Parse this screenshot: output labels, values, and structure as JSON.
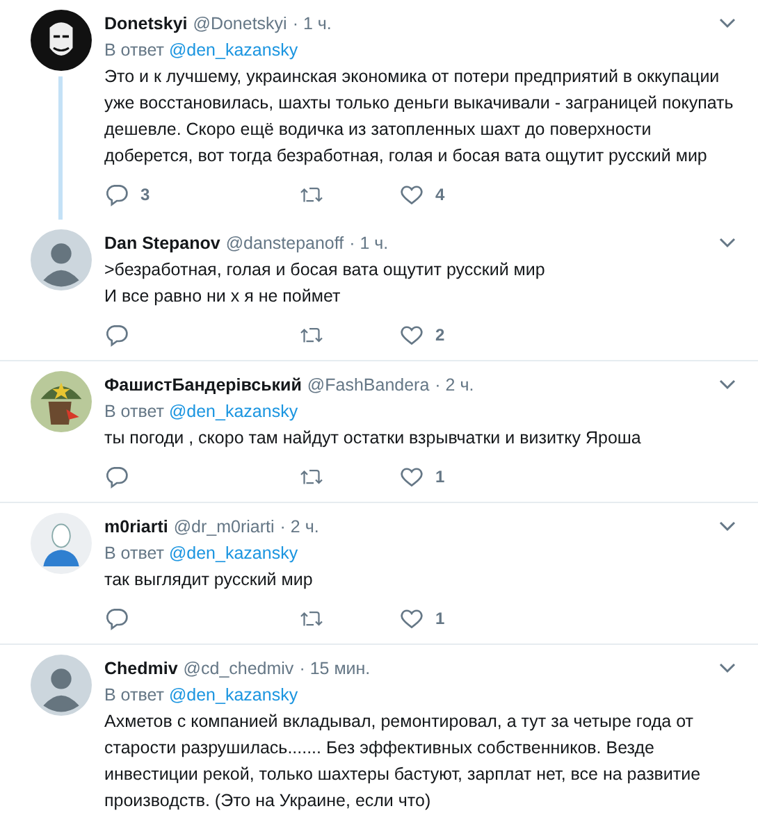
{
  "tweets": [
    {
      "avatar": {
        "kind": "mask"
      },
      "name": "Donetskyi",
      "handle": "@Donetskyi",
      "time": "· 1 ч.",
      "reply_label": "В ответ",
      "reply_to": "@den_kazansky",
      "lines": [
        "Это и к лучшему, украинская экономика от потери предприятий в оккупации уже восстановилась, шахты только деньги выкачивали - заграницей покупать дешевле. Скоро ещё водичка из затопленных шахт до поверхности доберется, вот тогда безработная, голая и босая вата ощутит русский мир"
      ],
      "actions": {
        "replies": "3",
        "likes": "4"
      },
      "thread_continues": true
    },
    {
      "avatar": {
        "kind": "default"
      },
      "name": "Dan Stepanov",
      "handle": "@danstepanoff",
      "time": "· 1 ч.",
      "lines": [
        ">безработная, голая и босая вата ощутит русский мир",
        "И все равно ни х я не поймет"
      ],
      "actions": {
        "likes": "2"
      },
      "thread_continues": false
    },
    {
      "avatar": {
        "kind": "helmet"
      },
      "name": "ФашистБандерівський",
      "handle": "@FashBandera",
      "time": "· 2 ч.",
      "reply_label": "В ответ",
      "reply_to": "@den_kazansky",
      "lines": [
        "ты погоди , скоро там найдут остатки взрывчатки и визитку Яроша"
      ],
      "actions": {
        "likes": "1"
      },
      "thread_continues": false
    },
    {
      "avatar": {
        "kind": "person"
      },
      "name": "m0riarti",
      "handle": "@dr_m0riarti",
      "time": "· 2 ч.",
      "reply_label": "В ответ",
      "reply_to": "@den_kazansky",
      "lines": [
        "так выглядит русский мир"
      ],
      "actions": {
        "likes": "1"
      },
      "thread_continues": false
    },
    {
      "avatar": {
        "kind": "default"
      },
      "name": "Chedmiv",
      "handle": "@cd_chedmiv",
      "time": "· 15 мин.",
      "reply_label": "В ответ",
      "reply_to": "@den_kazansky",
      "lines": [
        "Ахметов с компанией вкладывал, ремонтировал, а тут за четыре года от старости разрушилась....... Без эффективных собственников. Везде инвестиции рекой, только шахтеры бастуют, зарплат нет, все на развитие производств. (Это на Украине, если что)"
      ],
      "thread_continues": false
    }
  ]
}
